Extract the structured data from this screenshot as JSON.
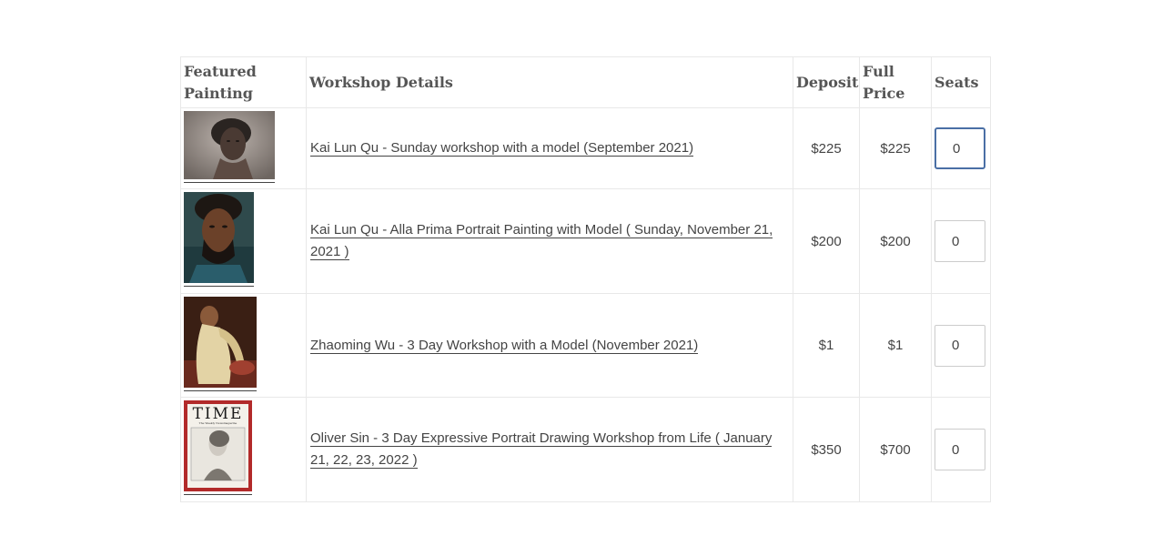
{
  "headers": {
    "featured": "Featured Painting",
    "details": "Workshop Details",
    "deposit": "Deposit",
    "full_price": "Full Price",
    "seats": "Seats"
  },
  "rows": [
    {
      "title": "Kai Lun Qu - Sunday workshop with a model (September 2021)",
      "deposit": "$225",
      "full_price": "$225",
      "seats": "0",
      "image": "portrait-woman-sketch"
    },
    {
      "title": "Kai Lun Qu - Alla Prima Portrait Painting with Model ( Sunday, November 21, 2021 )",
      "deposit": "$200",
      "full_price": "$200",
      "seats": "0",
      "image": "portrait-man-painting"
    },
    {
      "title": "Zhaoming Wu - 3 Day Workshop with a Model (November 2021)",
      "deposit": "$1",
      "full_price": "$1",
      "seats": "0",
      "image": "figure-painting"
    },
    {
      "title": "Oliver Sin - 3 Day Expressive Portrait Drawing Workshop from Life ( January 21, 22, 23, 2022 )",
      "deposit": "$350",
      "full_price": "$700",
      "seats": "0",
      "image": "time-magazine-cover"
    }
  ],
  "time_cover": {
    "masthead": "TIME",
    "subtitle": "The Weekly Newsmagazine"
  },
  "colors": {
    "time_red": "#b22a2a",
    "focus_blue": "#4a6fa5",
    "link_underline": "#444444"
  }
}
